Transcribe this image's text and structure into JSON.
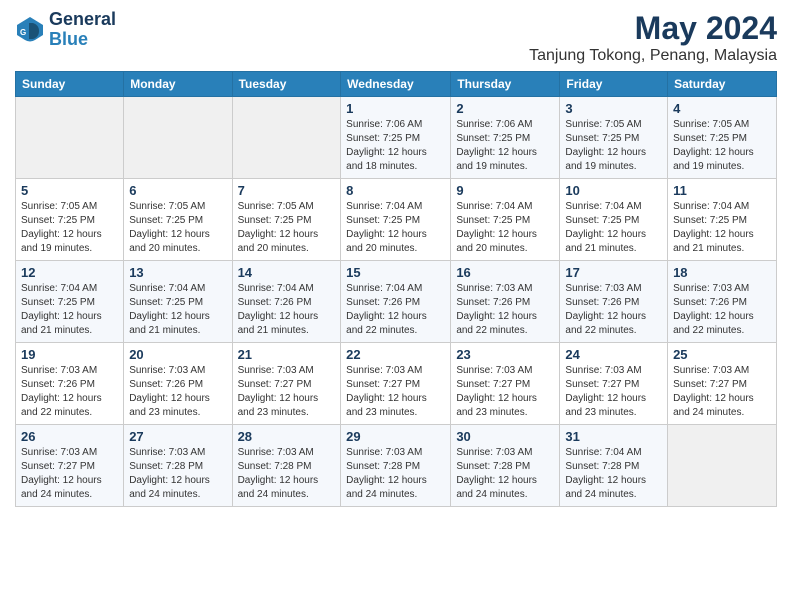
{
  "logo": {
    "line1": "General",
    "line2": "Blue"
  },
  "title": {
    "month_year": "May 2024",
    "location": "Tanjung Tokong, Penang, Malaysia"
  },
  "days_of_week": [
    "Sunday",
    "Monday",
    "Tuesday",
    "Wednesday",
    "Thursday",
    "Friday",
    "Saturday"
  ],
  "weeks": [
    [
      {
        "day": "",
        "info": ""
      },
      {
        "day": "",
        "info": ""
      },
      {
        "day": "",
        "info": ""
      },
      {
        "day": "1",
        "info": "Sunrise: 7:06 AM\nSunset: 7:25 PM\nDaylight: 12 hours\nand 18 minutes."
      },
      {
        "day": "2",
        "info": "Sunrise: 7:06 AM\nSunset: 7:25 PM\nDaylight: 12 hours\nand 19 minutes."
      },
      {
        "day": "3",
        "info": "Sunrise: 7:05 AM\nSunset: 7:25 PM\nDaylight: 12 hours\nand 19 minutes."
      },
      {
        "day": "4",
        "info": "Sunrise: 7:05 AM\nSunset: 7:25 PM\nDaylight: 12 hours\nand 19 minutes."
      }
    ],
    [
      {
        "day": "5",
        "info": "Sunrise: 7:05 AM\nSunset: 7:25 PM\nDaylight: 12 hours\nand 19 minutes."
      },
      {
        "day": "6",
        "info": "Sunrise: 7:05 AM\nSunset: 7:25 PM\nDaylight: 12 hours\nand 20 minutes."
      },
      {
        "day": "7",
        "info": "Sunrise: 7:05 AM\nSunset: 7:25 PM\nDaylight: 12 hours\nand 20 minutes."
      },
      {
        "day": "8",
        "info": "Sunrise: 7:04 AM\nSunset: 7:25 PM\nDaylight: 12 hours\nand 20 minutes."
      },
      {
        "day": "9",
        "info": "Sunrise: 7:04 AM\nSunset: 7:25 PM\nDaylight: 12 hours\nand 20 minutes."
      },
      {
        "day": "10",
        "info": "Sunrise: 7:04 AM\nSunset: 7:25 PM\nDaylight: 12 hours\nand 21 minutes."
      },
      {
        "day": "11",
        "info": "Sunrise: 7:04 AM\nSunset: 7:25 PM\nDaylight: 12 hours\nand 21 minutes."
      }
    ],
    [
      {
        "day": "12",
        "info": "Sunrise: 7:04 AM\nSunset: 7:25 PM\nDaylight: 12 hours\nand 21 minutes."
      },
      {
        "day": "13",
        "info": "Sunrise: 7:04 AM\nSunset: 7:25 PM\nDaylight: 12 hours\nand 21 minutes."
      },
      {
        "day": "14",
        "info": "Sunrise: 7:04 AM\nSunset: 7:26 PM\nDaylight: 12 hours\nand 21 minutes."
      },
      {
        "day": "15",
        "info": "Sunrise: 7:04 AM\nSunset: 7:26 PM\nDaylight: 12 hours\nand 22 minutes."
      },
      {
        "day": "16",
        "info": "Sunrise: 7:03 AM\nSunset: 7:26 PM\nDaylight: 12 hours\nand 22 minutes."
      },
      {
        "day": "17",
        "info": "Sunrise: 7:03 AM\nSunset: 7:26 PM\nDaylight: 12 hours\nand 22 minutes."
      },
      {
        "day": "18",
        "info": "Sunrise: 7:03 AM\nSunset: 7:26 PM\nDaylight: 12 hours\nand 22 minutes."
      }
    ],
    [
      {
        "day": "19",
        "info": "Sunrise: 7:03 AM\nSunset: 7:26 PM\nDaylight: 12 hours\nand 22 minutes."
      },
      {
        "day": "20",
        "info": "Sunrise: 7:03 AM\nSunset: 7:26 PM\nDaylight: 12 hours\nand 23 minutes."
      },
      {
        "day": "21",
        "info": "Sunrise: 7:03 AM\nSunset: 7:27 PM\nDaylight: 12 hours\nand 23 minutes."
      },
      {
        "day": "22",
        "info": "Sunrise: 7:03 AM\nSunset: 7:27 PM\nDaylight: 12 hours\nand 23 minutes."
      },
      {
        "day": "23",
        "info": "Sunrise: 7:03 AM\nSunset: 7:27 PM\nDaylight: 12 hours\nand 23 minutes."
      },
      {
        "day": "24",
        "info": "Sunrise: 7:03 AM\nSunset: 7:27 PM\nDaylight: 12 hours\nand 23 minutes."
      },
      {
        "day": "25",
        "info": "Sunrise: 7:03 AM\nSunset: 7:27 PM\nDaylight: 12 hours\nand 24 minutes."
      }
    ],
    [
      {
        "day": "26",
        "info": "Sunrise: 7:03 AM\nSunset: 7:27 PM\nDaylight: 12 hours\nand 24 minutes."
      },
      {
        "day": "27",
        "info": "Sunrise: 7:03 AM\nSunset: 7:28 PM\nDaylight: 12 hours\nand 24 minutes."
      },
      {
        "day": "28",
        "info": "Sunrise: 7:03 AM\nSunset: 7:28 PM\nDaylight: 12 hours\nand 24 minutes."
      },
      {
        "day": "29",
        "info": "Sunrise: 7:03 AM\nSunset: 7:28 PM\nDaylight: 12 hours\nand 24 minutes."
      },
      {
        "day": "30",
        "info": "Sunrise: 7:03 AM\nSunset: 7:28 PM\nDaylight: 12 hours\nand 24 minutes."
      },
      {
        "day": "31",
        "info": "Sunrise: 7:04 AM\nSunset: 7:28 PM\nDaylight: 12 hours\nand 24 minutes."
      },
      {
        "day": "",
        "info": ""
      }
    ]
  ],
  "colors": {
    "header_bg": "#2980b9",
    "header_text": "#ffffff",
    "title_color": "#1a3a5c",
    "row_odd": "#f5f8fc",
    "row_even": "#ffffff",
    "empty_cell": "#f0f0f0"
  }
}
